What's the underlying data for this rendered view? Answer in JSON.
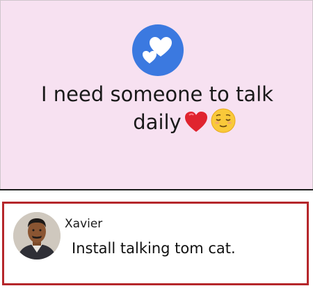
{
  "post": {
    "background_color": "#f7e1f1",
    "badge_icon": "two-hearts-icon",
    "badge_color": "#3b79e0",
    "status_line_1": "I need someone to talk",
    "status_line_2": "daily",
    "emojis": [
      "red-heart-emoji",
      "relieved-face-emoji"
    ]
  },
  "comment": {
    "author": "Xavier",
    "text": "Install talking tom cat.",
    "border_color": "#b5272b"
  }
}
